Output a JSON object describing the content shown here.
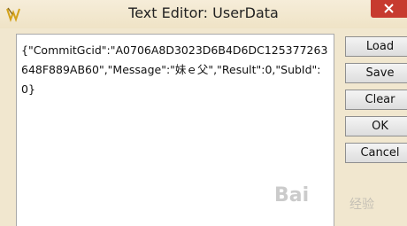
{
  "window": {
    "title": "Text Editor: UserData"
  },
  "editor": {
    "content": "{\"CommitGcid\":\"A0706A8D3023D6B4D6DC125377263648F889AB60\",\"Message\":\"妹ｅ父\",\"Result\":0,\"SubId\":0}"
  },
  "buttons": {
    "load": "Load",
    "save": "Save",
    "clear": "Clear",
    "ok": "OK",
    "cancel": "Cancel"
  },
  "watermark": {
    "brand": "Bai",
    "sub": "经验"
  },
  "colors": {
    "close_button": "#c73b2f",
    "window_bg": "#f1e7cf"
  }
}
